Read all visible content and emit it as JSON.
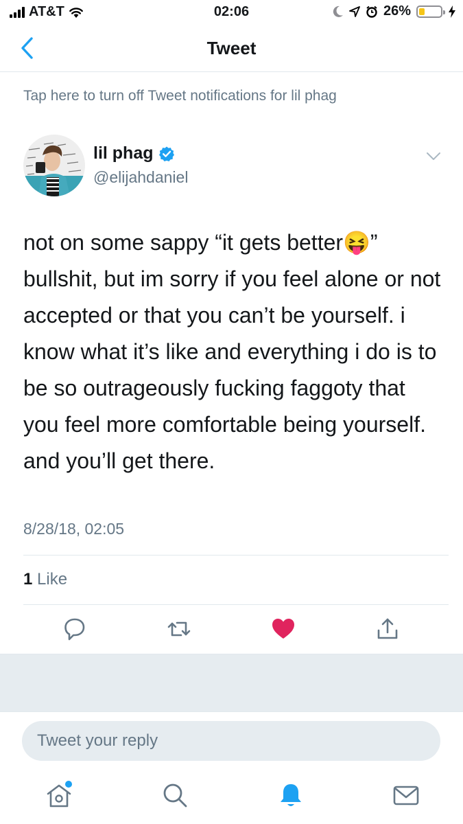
{
  "status_bar": {
    "carrier": "AT&T",
    "time": "02:06",
    "battery": "26%",
    "battery_level": 0.26
  },
  "nav": {
    "title": "Tweet"
  },
  "notification_banner": "Tap here to turn off Tweet notifications for lil phag",
  "tweet": {
    "author_name": "lil phag",
    "author_handle": "@elijahdaniel",
    "text": "not on some sappy “it gets better😝” bullshit, but im sorry if you feel alone or not accepted or that you can’t be yourself. i know what it’s like and everything i do is to be so outrageously fucking faggoty that you feel more comfortable being yourself. and you’ll get there.",
    "timestamp": "8/28/18, 02:05",
    "like_count": "1",
    "like_label": "Like",
    "liked": true
  },
  "reply": {
    "placeholder": "Tweet your reply"
  },
  "colors": {
    "accent": "#1da1f2",
    "like": "#e0245e",
    "secondary_text": "#657786",
    "border": "#e1e8ed"
  },
  "icons": {
    "actions": [
      "reply-icon",
      "retweet-icon",
      "like-icon",
      "share-icon"
    ],
    "tabs": [
      "home-icon",
      "search-icon",
      "notifications-icon",
      "messages-icon"
    ]
  }
}
